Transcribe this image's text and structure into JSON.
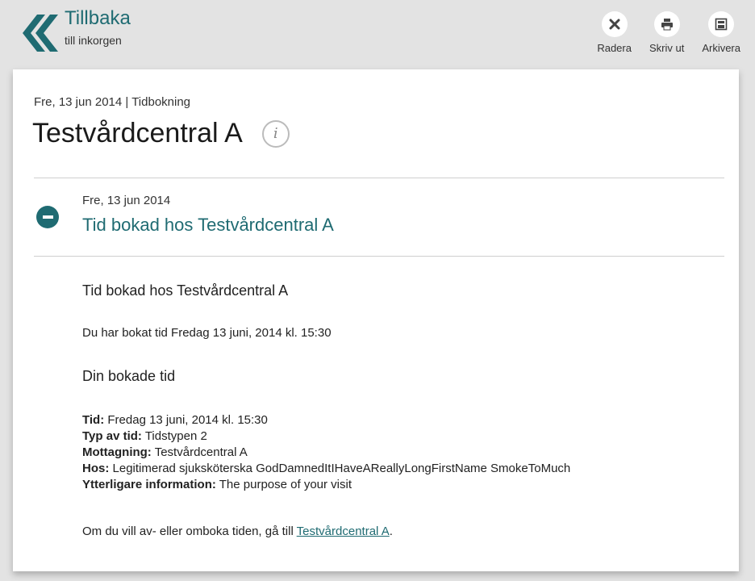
{
  "header": {
    "back_title": "Tillbaka",
    "back_subtitle": "till inkorgen",
    "actions": [
      {
        "label": "Radera",
        "icon": "delete-icon"
      },
      {
        "label": "Skriv ut",
        "icon": "print-icon"
      },
      {
        "label": "Arkivera",
        "icon": "archive-icon"
      }
    ]
  },
  "message": {
    "meta": "Fre, 13 jun 2014 | Tidbokning",
    "title": "Testvårdcentral A",
    "entry_date": "Fre, 13 jun 2014",
    "entry_subject": "Tid bokad hos Testvårdcentral A",
    "body_title": "Tid bokad hos Testvårdcentral A",
    "body_line": "Du har bokat tid Fredag 13 juni, 2014 kl. 15:30",
    "section_title": "Din bokade tid",
    "details": [
      {
        "label": "Tid:",
        "value": "Fredag 13 juni, 2014 kl. 15:30"
      },
      {
        "label": "Typ av tid:",
        "value": "Tidstypen 2"
      },
      {
        "label": "Mottagning:",
        "value": "Testvårdcentral A"
      },
      {
        "label": "Hos:",
        "value": "Legitimerad sjuksköterska GodDamnedItIHaveAReallyLongFirstName SmokeToMuch"
      },
      {
        "label": "Ytterligare information:",
        "value": "The purpose of your visit"
      }
    ],
    "footer_prefix": "Om du vill av- eller omboka tiden, gå till ",
    "footer_link": "Testvårdcentral A",
    "footer_suffix": "."
  },
  "colors": {
    "accent": "#1f6b72",
    "background": "#e3e3e3",
    "card": "#ffffff"
  }
}
